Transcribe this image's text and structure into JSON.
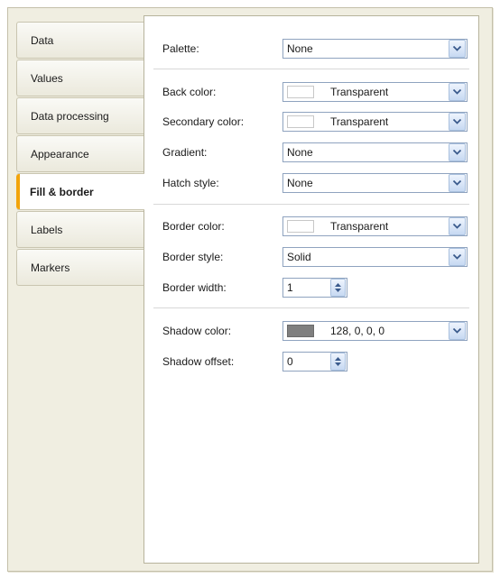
{
  "tabs": [
    {
      "label": "Data"
    },
    {
      "label": "Values"
    },
    {
      "label": "Data processing"
    },
    {
      "label": "Appearance"
    },
    {
      "label": "Fill & border",
      "active": true
    },
    {
      "label": "Labels"
    },
    {
      "label": "Markers"
    }
  ],
  "fields": {
    "palette": {
      "label": "Palette:",
      "value": "None"
    },
    "back_color": {
      "label": "Back color:",
      "value": "Transparent"
    },
    "secondary_color": {
      "label": "Secondary color:",
      "value": "Transparent"
    },
    "gradient": {
      "label": "Gradient:",
      "value": "None"
    },
    "hatch_style": {
      "label": "Hatch style:",
      "value": "None"
    },
    "border_color": {
      "label": "Border color:",
      "value": "Transparent"
    },
    "border_style": {
      "label": "Border style:",
      "value": "Solid"
    },
    "border_width": {
      "label": "Border width:",
      "value": "1"
    },
    "shadow_color": {
      "label": "Shadow color:",
      "value": "128, 0, 0, 0",
      "swatch": "#7f7f7f"
    },
    "shadow_offset": {
      "label": "Shadow offset:",
      "value": "0"
    }
  },
  "colors": {
    "accent": "#f2a40c",
    "panel_bg": "#f0eee1",
    "transparent_swatch": "#ffffff"
  }
}
